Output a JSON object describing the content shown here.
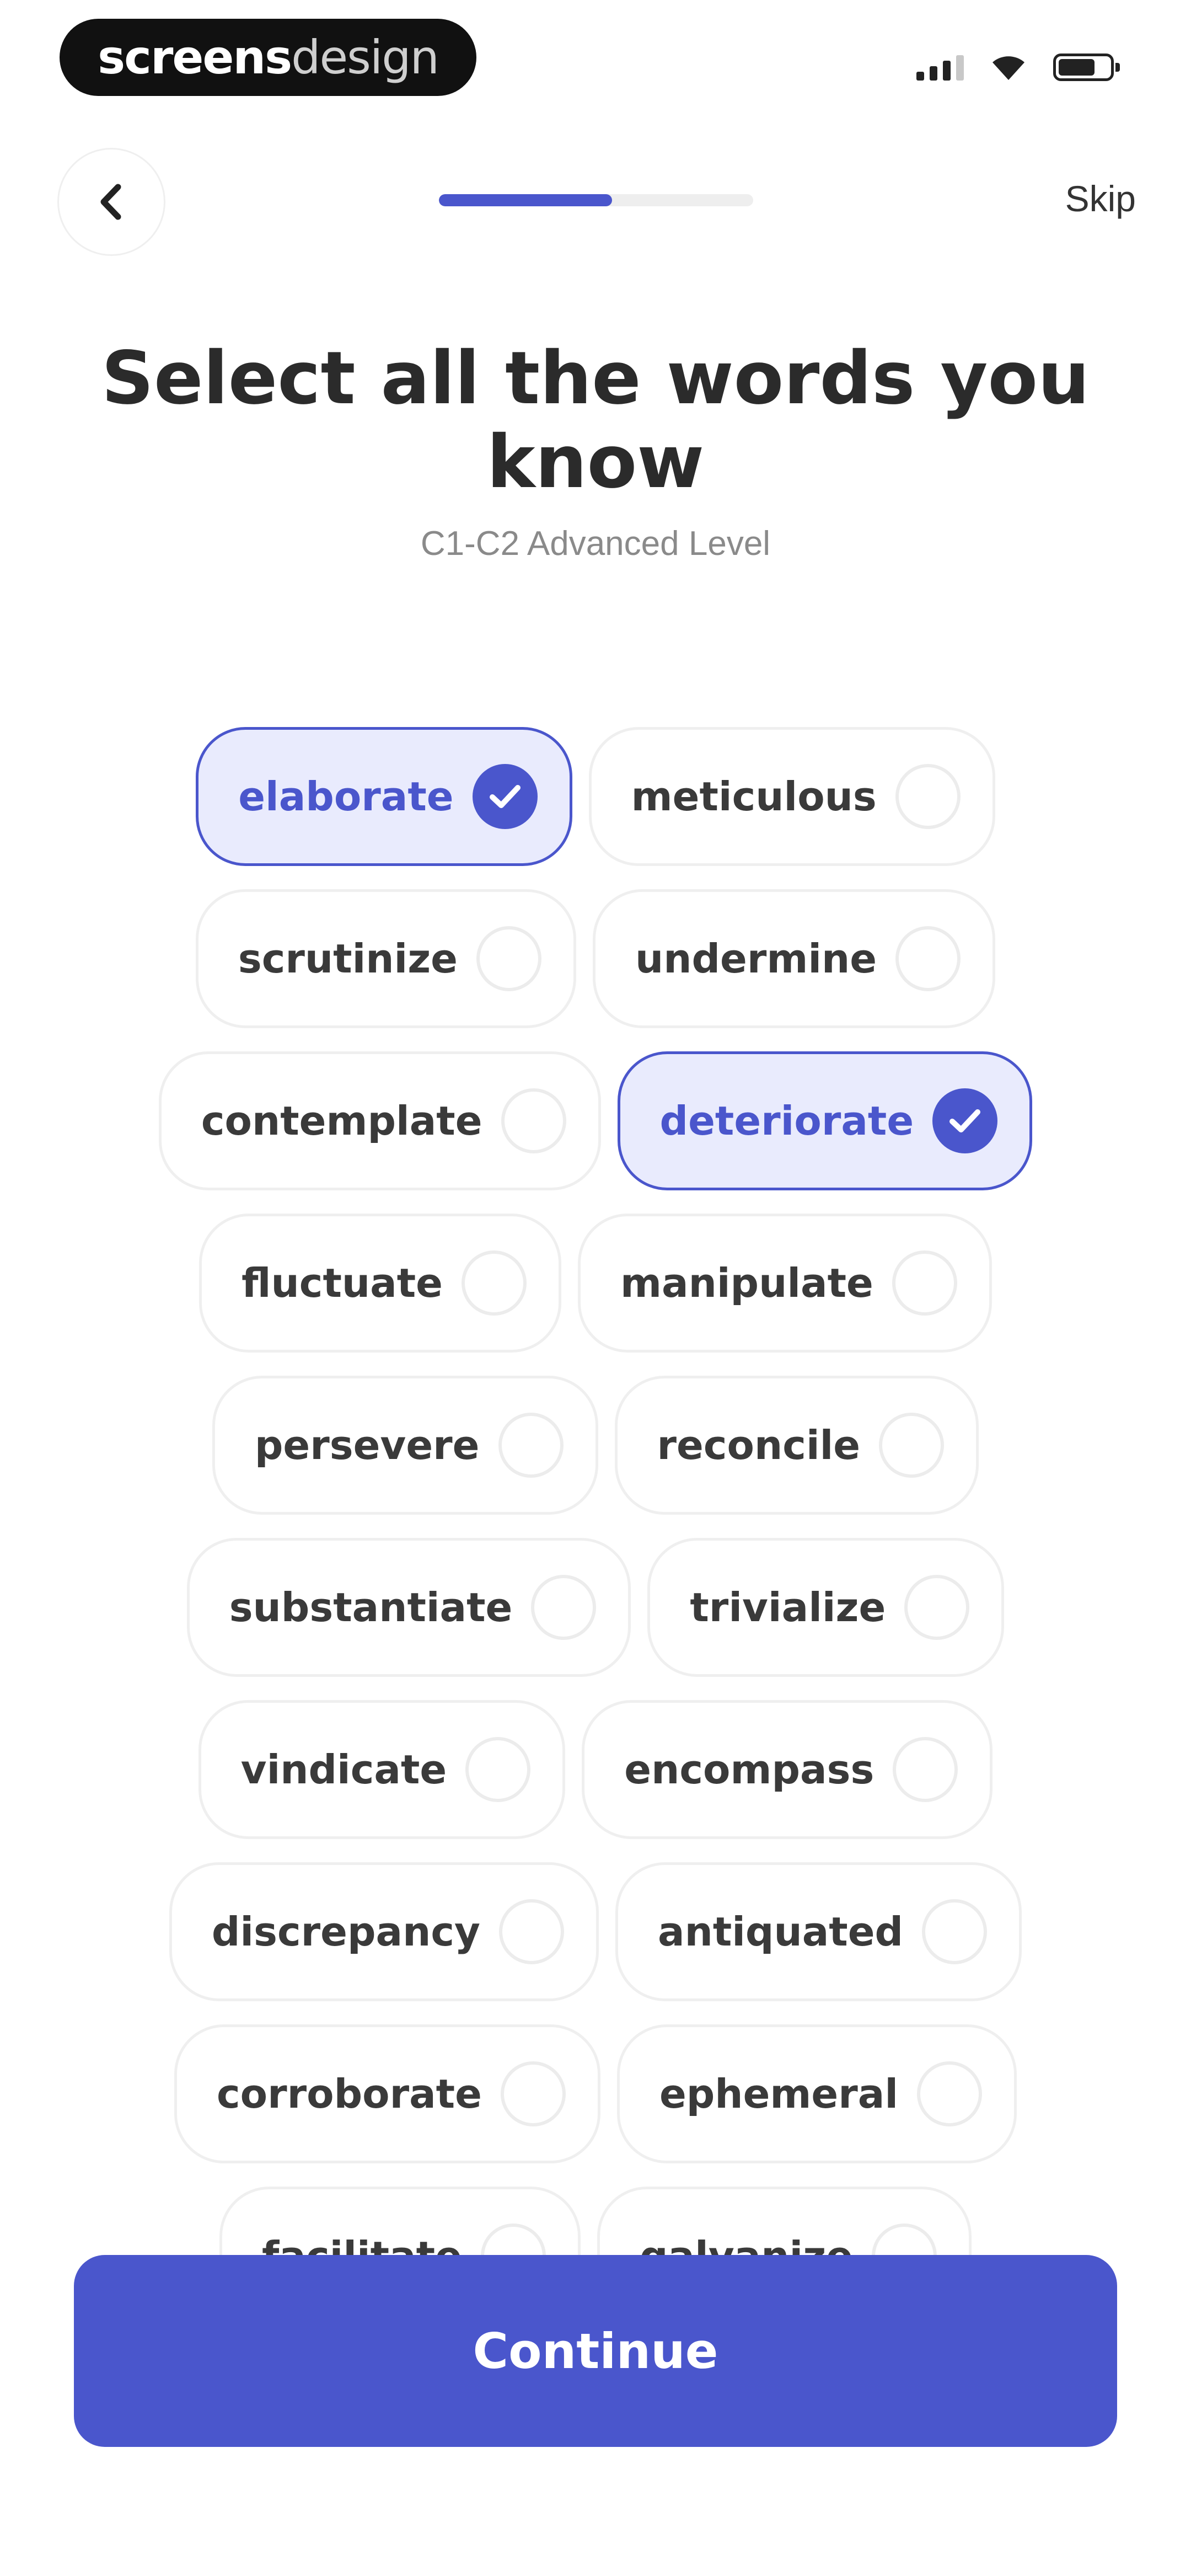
{
  "status_bar": {
    "brand_bold": "screens",
    "brand_light": "design",
    "icons": [
      "signal-icon",
      "wifi-icon",
      "battery-icon"
    ]
  },
  "header": {
    "back_icon": "chevron-left-icon",
    "progress_fraction": 0.55,
    "skip_label": "Skip"
  },
  "title": "Select all the words you know",
  "subtitle": "C1-C2 Advanced Level",
  "accent_color": "#4a56cc",
  "selected_bg_color": "#e9ebfd",
  "words": [
    [
      {
        "label": "elaborate",
        "selected": true
      },
      {
        "label": "meticulous",
        "selected": false
      }
    ],
    [
      {
        "label": "scrutinize",
        "selected": false
      },
      {
        "label": "undermine",
        "selected": false
      }
    ],
    [
      {
        "label": "contemplate",
        "selected": false
      },
      {
        "label": "deteriorate",
        "selected": true
      }
    ],
    [
      {
        "label": "fluctuate",
        "selected": false
      },
      {
        "label": "manipulate",
        "selected": false
      }
    ],
    [
      {
        "label": "persevere",
        "selected": false
      },
      {
        "label": "reconcile",
        "selected": false
      }
    ],
    [
      {
        "label": "substantiate",
        "selected": false
      },
      {
        "label": "trivialize",
        "selected": false
      }
    ],
    [
      {
        "label": "vindicate",
        "selected": false
      },
      {
        "label": "encompass",
        "selected": false
      }
    ],
    [
      {
        "label": "discrepancy",
        "selected": false
      },
      {
        "label": "antiquated",
        "selected": false
      }
    ],
    [
      {
        "label": "corroborate",
        "selected": false
      },
      {
        "label": "ephemeral",
        "selected": false
      }
    ],
    [
      {
        "label": "facilitate",
        "selected": false
      },
      {
        "label": "galvanize",
        "selected": false
      }
    ]
  ],
  "continue_label": "Continue"
}
